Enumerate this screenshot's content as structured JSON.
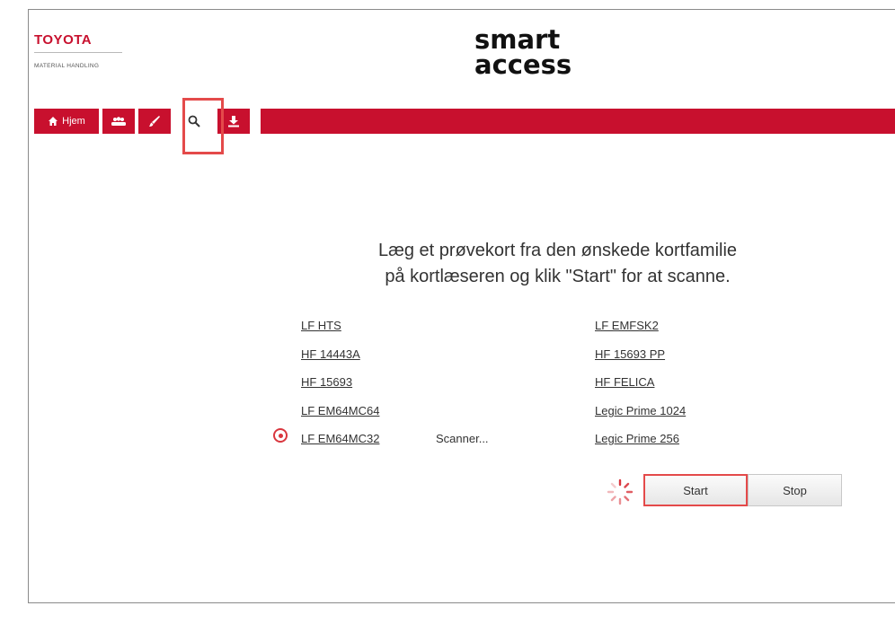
{
  "header": {
    "brand": "TOYOTA",
    "brand_subtitle": "MATERIAL HANDLING",
    "app_title_line1": "smart",
    "app_title_line2": "access"
  },
  "nav": {
    "home_label": "Hjem",
    "items": [
      {
        "icon": "home-icon",
        "label": "Hjem"
      },
      {
        "icon": "users-icon"
      },
      {
        "icon": "brush-icon"
      },
      {
        "icon": "search-icon",
        "selected": true
      },
      {
        "icon": "download-icon"
      }
    ]
  },
  "instruction": {
    "line1": "Læg et prøvekort fra den ønskede kortfamilie",
    "line2": "på kortlæseren og klik \"Start\" for at scanne."
  },
  "card_families": {
    "left": [
      "LF HTS",
      "HF 14443A",
      "HF 15693",
      "LF EM64MC64",
      "LF EM64MC32"
    ],
    "right": [
      "LF EMFSK2",
      "HF 15693 PP",
      "HF FELICA",
      "Legic Prime 1024",
      "Legic Prime 256"
    ],
    "scanning_index": 4
  },
  "scan_status": "Scanner...",
  "buttons": {
    "start": "Start",
    "stop": "Stop"
  },
  "colors": {
    "brand_red": "#c8102e",
    "highlight": "#e44a4a"
  }
}
